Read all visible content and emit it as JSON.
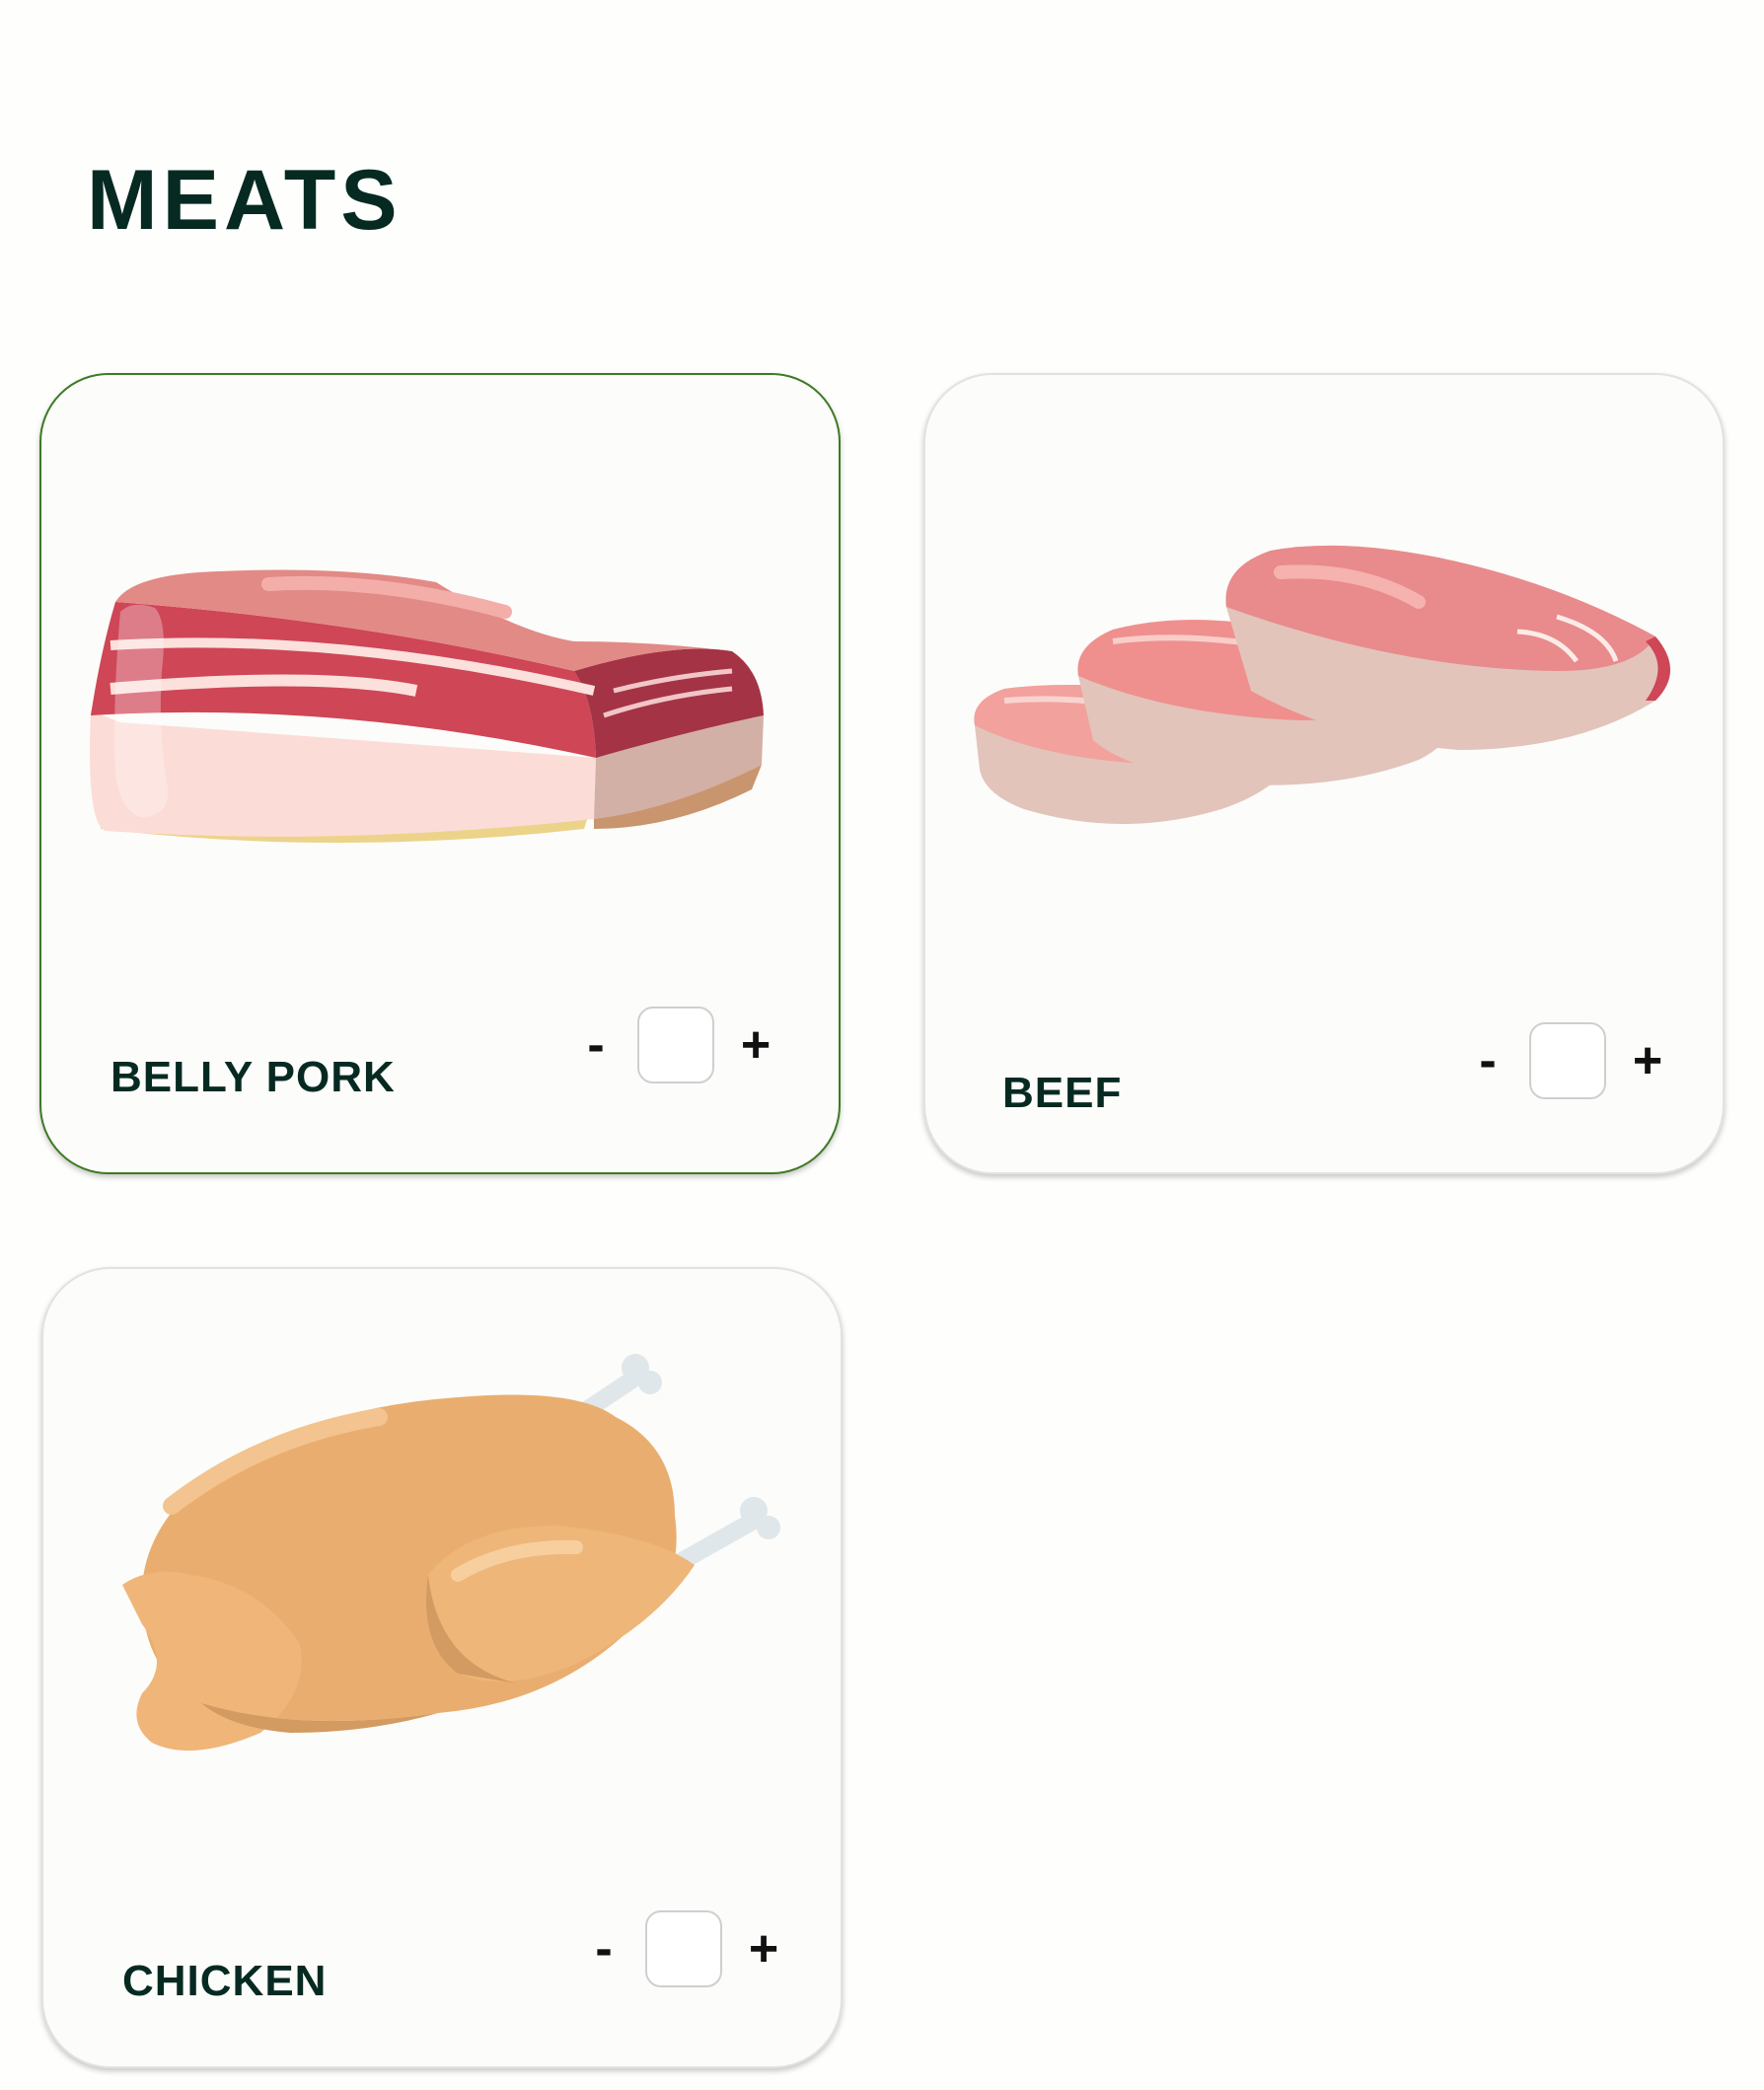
{
  "page": {
    "title": "MEATS"
  },
  "products": [
    {
      "name": "BELLY PORK",
      "selected": true,
      "quantity": "",
      "minus": "-",
      "plus": "+",
      "illustration": "belly-pork"
    },
    {
      "name": "BEEF",
      "selected": false,
      "quantity": "",
      "minus": "-",
      "plus": "+",
      "illustration": "beef-steaks"
    },
    {
      "name": "CHICKEN",
      "selected": false,
      "quantity": "",
      "minus": "-",
      "plus": "+",
      "illustration": "whole-chicken"
    }
  ],
  "colors": {
    "title": "#062a22",
    "selected_border": "#3d7a24",
    "card_bg": "#fcfcfa"
  }
}
